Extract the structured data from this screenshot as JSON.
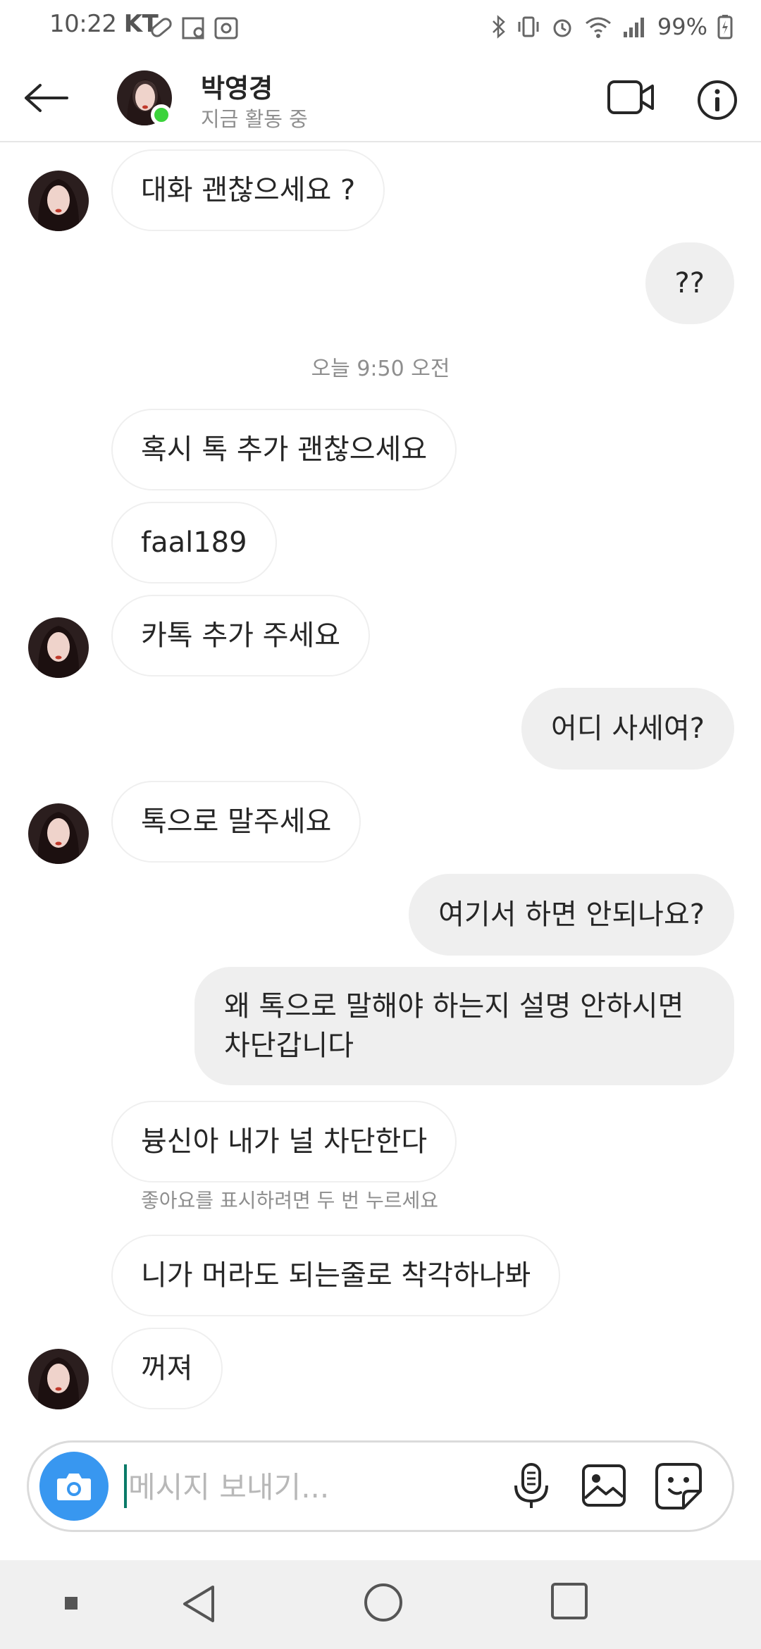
{
  "status_bar": {
    "time": "10:22",
    "carrier": "KT",
    "battery": "99%",
    "icons": [
      "bluetooth-icon",
      "vibrate-icon",
      "alarm-icon",
      "wifi-icon",
      "signal-icon",
      "battery-charging-icon"
    ]
  },
  "header": {
    "name": "박영경",
    "status": "지금 활동 중",
    "icons": [
      "back-arrow-icon",
      "video-call-icon",
      "info-icon"
    ]
  },
  "messages": [
    {
      "side": "in",
      "text": "대화 괜찮으세요 ?"
    },
    {
      "side": "out",
      "text": "??"
    },
    {
      "side": "in",
      "text": "혹시 톡 추가 괜찮으세요"
    },
    {
      "side": "in",
      "text": "faal189"
    },
    {
      "side": "in",
      "text": "카톡 추가 주세요"
    },
    {
      "side": "out",
      "text": "어디 사세여?"
    },
    {
      "side": "in",
      "text": "톡으로 말주세요"
    },
    {
      "side": "out",
      "text": "여기서 하면 안되나요?"
    },
    {
      "side": "out",
      "text": "왜 톡으로 말해야 하는지 설명 안하시면 차단갑니다"
    },
    {
      "side": "in",
      "text": "븅신아 내가 널 차단한다"
    },
    {
      "side": "in",
      "text": "니가 머라도 되는줄로 착각하나봐"
    },
    {
      "side": "in",
      "text": "꺼져"
    }
  ],
  "timestamp": "오늘 9:50 오전",
  "like_hint": "좋아요를 표시하려면 두 번 누르세요",
  "composer": {
    "placeholder": "메시지 보내기...",
    "value": "",
    "icons": [
      "camera-icon",
      "microphone-icon",
      "gallery-icon",
      "sticker-icon"
    ]
  },
  "nav_bar": {
    "icons": [
      "nav-dot-icon",
      "nav-back-icon",
      "nav-home-icon",
      "nav-recents-icon"
    ]
  },
  "colors": {
    "accent_blue": "#3897f0",
    "online_green": "#3bd33b",
    "outgoing_bubble": "#efefef",
    "caret_teal": "#0a7a68"
  }
}
